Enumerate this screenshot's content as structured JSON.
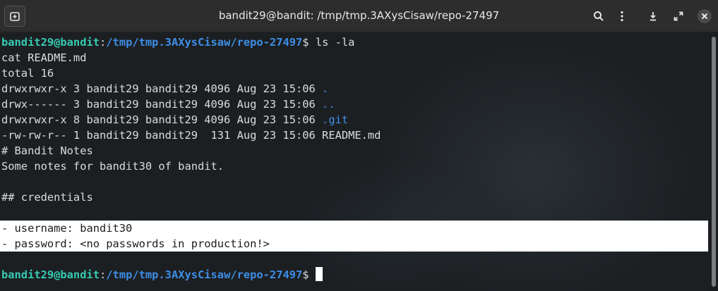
{
  "window": {
    "title": "bandit29@bandit: /tmp/tmp.3AXysCisaw/repo-27497"
  },
  "prompt": {
    "user": "bandit29@bandit",
    "colon": ":",
    "path": "/tmp/tmp.3AXysCisaw/repo-27497",
    "symbol": "$"
  },
  "lines": {
    "cmd": " ls -la",
    "l1": "cat README.md",
    "l2": "total 16",
    "r1": {
      "meta": "drwxrwxr-x 3 bandit29 bandit29 4096 Aug 23 15:06 ",
      "name": "."
    },
    "r2": {
      "meta": "drwx------ 3 bandit29 bandit29 4096 Aug 23 15:06 ",
      "name": ".."
    },
    "r3": {
      "meta": "drwxrwxr-x 8 bandit29 bandit29 4096 Aug 23 15:06 ",
      "name": ".git"
    },
    "r4": {
      "meta": "-rw-rw-r-- 1 bandit29 bandit29  131 Aug 23 15:06 ",
      "name": "README.md"
    },
    "n1": "# Bandit Notes",
    "n2": "Some notes for bandit30 of bandit.",
    "n3": "## credentials",
    "c1": "- username: bandit30",
    "c2": "- password: <no passwords in production!>"
  },
  "icons": {
    "new_tab": "new-tab-icon",
    "search": "search-icon",
    "menu": "menu-icon",
    "minimize": "minimize-icon",
    "maximize": "maximize-icon",
    "close": "close-icon"
  },
  "colors": {
    "user": "#36cbb2",
    "path": "#3d8ee6",
    "highlight_bg": "#ffffff"
  }
}
